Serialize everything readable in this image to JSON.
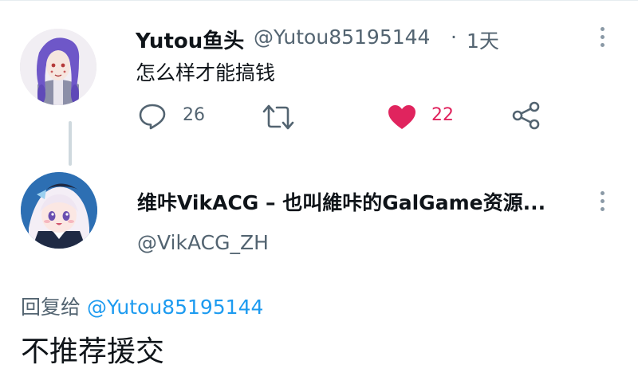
{
  "tweet": {
    "author_name": "Yutou鱼头",
    "author_handle": "@Yutou85195144",
    "separator": "·",
    "time": "1天",
    "text": "怎么样才能搞钱",
    "reply_count": "26",
    "like_count": "22",
    "liked": true,
    "icons": [
      "reply-icon",
      "retweet-icon",
      "heart-icon",
      "share-icon",
      "more-icon"
    ]
  },
  "reply": {
    "author_name": "维咔VikACG – 也叫維咔的GalGame资源...",
    "author_handle": "@VikACG_ZH",
    "reply_to_label": "回复给",
    "reply_to_handle": "@Yutou85195144",
    "text": "不推荐援交"
  },
  "colors": {
    "like_red": "#e0245e",
    "link_blue": "#1d9bf0",
    "secondary_text": "#536471",
    "primary_text": "#0f1419"
  }
}
